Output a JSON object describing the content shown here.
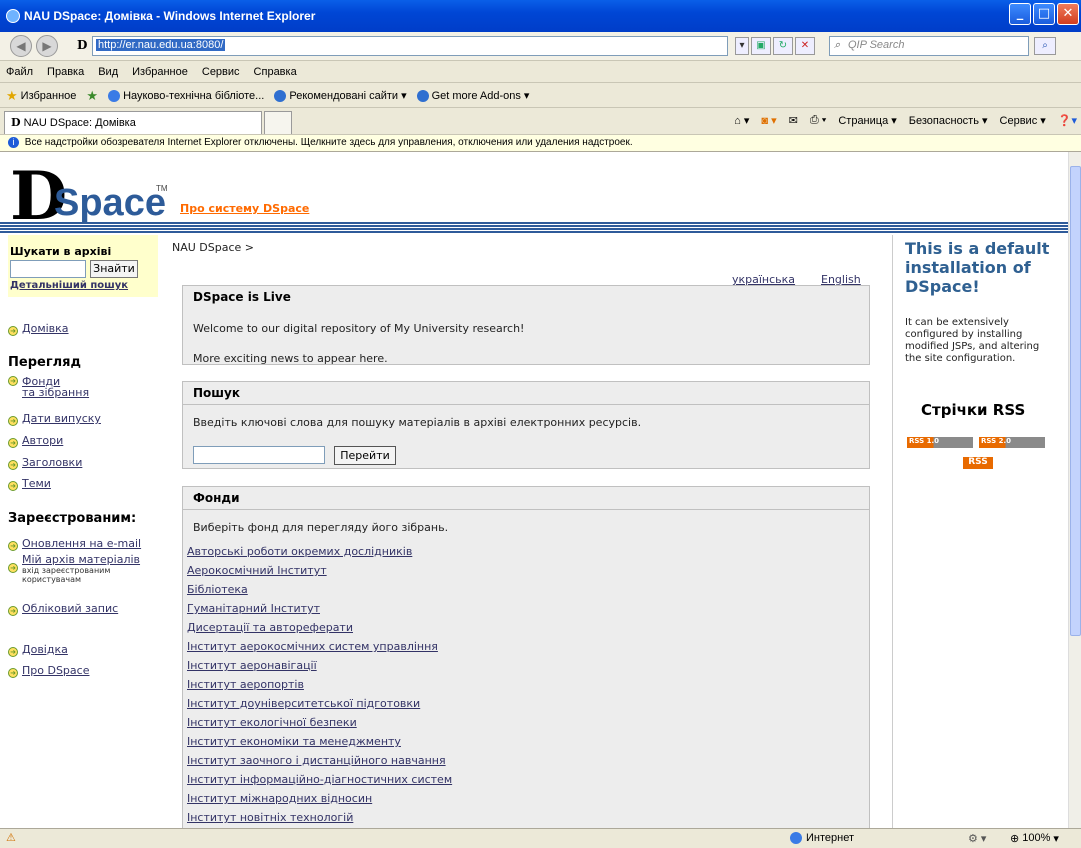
{
  "window": {
    "title": "NAU DSpace: Домівка - Windows Internet Explorer"
  },
  "address": {
    "url": "http://er.nau.edu.ua:8080/",
    "search_placeholder": "QIP Search"
  },
  "menu": [
    "Файл",
    "Правка",
    "Вид",
    "Избранное",
    "Сервис",
    "Справка"
  ],
  "favorites": {
    "label": "Избранное",
    "items": [
      "Науково-технічна бібліоте...",
      "Рекомендовані сайти ▾",
      "Get more Add-ons ▾"
    ]
  },
  "tab": {
    "title": "NAU DSpace: Домівка"
  },
  "commandbar": [
    "Страница ▾",
    "Безопасность ▾",
    "Сервис ▾"
  ],
  "infobar": {
    "text": "Все надстройки обозревателя Internet Explorer отключены. Щелкните здесь для управления, отключения или удаления надстроек."
  },
  "header": {
    "logo_d": "D",
    "logo_space": "Space",
    "tm": "TM",
    "about_link": "Про систему DSpace"
  },
  "left": {
    "search_title": "Шукати в архіві",
    "search_button": "Знайти",
    "advanced_search": "Детальніший пошук",
    "home": "Домівка",
    "browse_title": "Перегляд",
    "browse_items": [
      "Фонди\nта зібрання",
      "Дати випуску",
      "Автори",
      "Заголовки",
      "Теми"
    ],
    "registered_title": "Зареєстрованим:",
    "email_updates": "Оновлення на e-mail",
    "my_archive": "Мій архів матеріалів",
    "my_archive_note": "вхід зареєстрованим користувачам",
    "profile": "Обліковий запис",
    "help": "Довідка",
    "about": "Про DSpace"
  },
  "main": {
    "breadcrumb": "NAU DSpace >",
    "lang_uk": "українська",
    "lang_en": "English",
    "news_title": "DSpace is Live",
    "news_line1": "Welcome to our digital repository of My University research!",
    "news_line2": "More exciting news to appear here.",
    "search_title": "Пошук",
    "search_desc": "Введіть ключові слова для пошуку матеріалів в архіві електронних ресурсів.",
    "search_button": "Перейти",
    "comm_title": "Фонди",
    "comm_desc": "Виберіть фонд для перегляду його зібрань.",
    "communities": [
      "Авторські роботи окремих дослідників",
      "Аерокосмічний Інститут",
      "Бібліотека",
      "Гуманітарний Інститут",
      "Дисертації та автореферати",
      "Інститут аерокосмічних систем управління",
      "Інститут аеронавігації",
      "Інститут аеропортів",
      "Інститут доуніверситетської підготовки",
      "Інститут екологічної безпеки",
      "Інститут економіки та менеджменту",
      "Інститут заочного і дистанційного навчання",
      "Інститут інформаційно-діагностичних систем",
      "Інститут міжнародних відносин",
      "Інститут новітніх технологій"
    ]
  },
  "right": {
    "title": "This is a default installation of DSpace!",
    "text": "It can be extensively configured by installing modified JSPs, and altering the site configuration.",
    "rss_title": "Стрічки RSS",
    "rss1": "RSS 1.0",
    "rss2": "RSS 2.0",
    "rss": "RSS"
  },
  "status": {
    "zone": "Интернет",
    "zoom": "100%"
  }
}
